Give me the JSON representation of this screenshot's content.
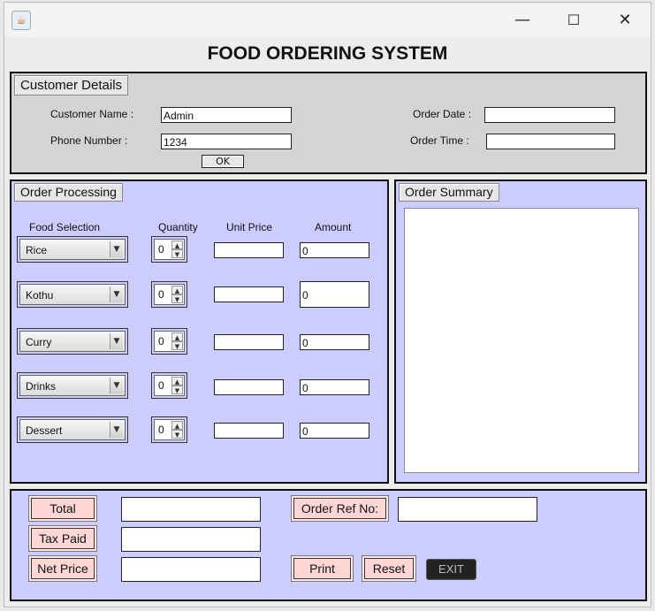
{
  "window": {
    "app_icon": "java-cup-icon"
  },
  "title": "FOOD ORDERING SYSTEM",
  "customer": {
    "panel_title": "Customer Details",
    "name_label": "Customer Name :",
    "name_value": "Admin",
    "phone_label": "Phone Number :",
    "phone_value": "1234",
    "date_label": "Order Date :",
    "date_value": "",
    "time_label": "Order Time :",
    "time_value": "",
    "ok_label": "OK"
  },
  "processing": {
    "panel_title": "Order Processing",
    "headers": {
      "food": "Food Selection",
      "qty": "Quantity",
      "price": "Unit Price",
      "amount": "Amount"
    },
    "rows": [
      {
        "food": "Rice",
        "qty": "0",
        "price": "",
        "amount": "0"
      },
      {
        "food": "Kothu",
        "qty": "0",
        "price": "",
        "amount": "0"
      },
      {
        "food": "Curry",
        "qty": "0",
        "price": "",
        "amount": "0"
      },
      {
        "food": "Drinks",
        "qty": "0",
        "price": "",
        "amount": "0"
      },
      {
        "food": "Dessert",
        "qty": "0",
        "price": "",
        "amount": "0"
      }
    ]
  },
  "summary": {
    "panel_title": "Order Summary",
    "text": ""
  },
  "bottom": {
    "total_label": "Total",
    "total_value": "",
    "tax_label": "Tax Paid",
    "tax_value": "",
    "net_label": "Net Price",
    "net_value": "",
    "ref_label": "Order Ref No:",
    "ref_value": "",
    "print_label": "Print",
    "reset_label": "Reset",
    "exit_label": "EXIT"
  },
  "colors": {
    "panel_blue": "#ccccff",
    "panel_gray": "#d4d4d4",
    "button_pink": "#ffd6d6"
  }
}
